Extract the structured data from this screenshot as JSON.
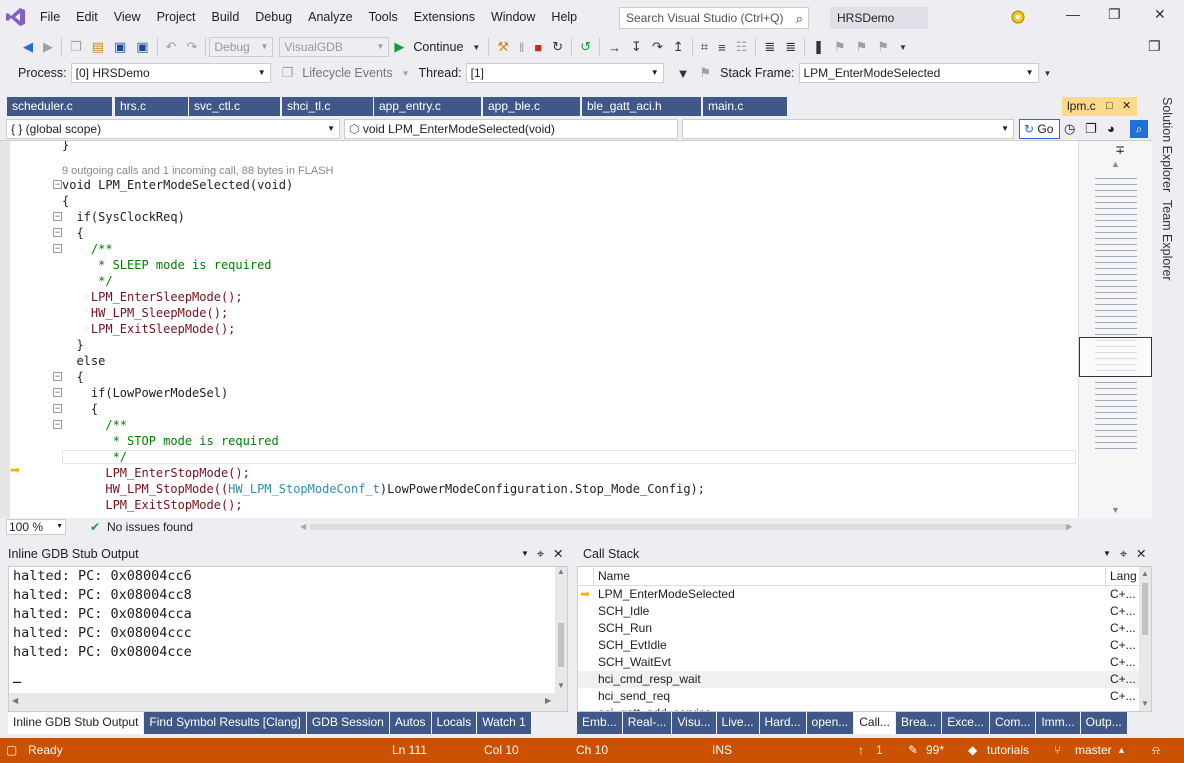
{
  "app": {
    "solution_name": "HRSDemo"
  },
  "menu": [
    "File",
    "Edit",
    "View",
    "Project",
    "Build",
    "Debug",
    "Analyze",
    "Tools",
    "Extensions",
    "Window",
    "Help"
  ],
  "search": {
    "placeholder": "Search Visual Studio (Ctrl+Q)"
  },
  "toolbar": {
    "config": "Debug",
    "platform": "VisualGDB",
    "continue_label": "Continue",
    "process_label": "Process:",
    "process_value": "[0] HRSDemo",
    "lifecycle_label": "Lifecycle Events",
    "thread_label": "Thread:",
    "thread_value": "[1]",
    "stackframe_label": "Stack Frame:",
    "stackframe_value": "LPM_EnterModeSelected"
  },
  "tabs": [
    "scheduler.c",
    "hrs.c",
    "svc_ctl.c",
    "shci_tl.c",
    "app_entry.c",
    "app_ble.c",
    "ble_gatt_aci.h",
    "main.c"
  ],
  "active_tab": "lpm.c",
  "navbar": {
    "scope": "{ } (global scope)",
    "function": "void LPM_EnterModeSelected(void)",
    "go_label": "Go"
  },
  "editor": {
    "codelens": "9 outgoing calls and 1 incoming call, 88 bytes in FLASH",
    "lines": [
      {
        "id": "l0",
        "text": "}"
      },
      {
        "id": "l1",
        "text": "void LPM_EnterModeSelected(void)"
      },
      {
        "id": "l2",
        "text": "{"
      },
      {
        "id": "l3",
        "text": "  if(SysClockReq)"
      },
      {
        "id": "l4",
        "text": "  {"
      },
      {
        "id": "l5",
        "text": "    /**"
      },
      {
        "id": "l6",
        "text": "     * SLEEP mode is required"
      },
      {
        "id": "l7",
        "text": "     */"
      },
      {
        "id": "l8",
        "text": "    LPM_EnterSleepMode();"
      },
      {
        "id": "l9",
        "text": "    HW_LPM_SleepMode();"
      },
      {
        "id": "l10",
        "text": "    LPM_ExitSleepMode();"
      },
      {
        "id": "l11",
        "text": "  }"
      },
      {
        "id": "l12",
        "text": "  else"
      },
      {
        "id": "l13",
        "text": "  {"
      },
      {
        "id": "l14",
        "text": "    if(LowPowerModeSel)"
      },
      {
        "id": "l15",
        "text": "    {"
      },
      {
        "id": "l16",
        "text": "      /**"
      },
      {
        "id": "l17",
        "text": "       * STOP mode is required"
      },
      {
        "id": "l18",
        "text": "       */"
      },
      {
        "id": "l19",
        "text": "      LPM_EnterStopMode();"
      },
      {
        "id": "l20a",
        "text": "      HW_LPM_StopMode(("
      },
      {
        "id": "l20b",
        "text": "HW_LPM_StopModeConf_t"
      },
      {
        "id": "l20c",
        "text": ")LowPowerModeConfiguration.Stop_Mode_Config);"
      },
      {
        "id": "l21",
        "text": "      LPM_ExitStopMode();"
      }
    ],
    "zoom": "100 %",
    "issues": "No issues found"
  },
  "gdb": {
    "title": "Inline GDB Stub Output",
    "lines": [
      "halted: PC: 0x08004cc6",
      "halted: PC: 0x08004cc8",
      "halted: PC: 0x08004cca",
      "halted: PC: 0x08004ccc",
      "halted: PC: 0x08004cce"
    ],
    "cursor": "_"
  },
  "bottom_left_tabs": [
    "Inline GDB Stub Output",
    "Find Symbol Results [Clang]",
    "GDB Session",
    "Autos",
    "Locals",
    "Watch 1"
  ],
  "callstack": {
    "title": "Call Stack",
    "columns": [
      "Name",
      "Lang"
    ],
    "rows": [
      {
        "name": "LPM_EnterModeSelected",
        "lang": "C+..."
      },
      {
        "name": "SCH_Idle",
        "lang": "C+..."
      },
      {
        "name": "SCH_Run",
        "lang": "C+..."
      },
      {
        "name": "SCH_EvtIdle",
        "lang": "C+..."
      },
      {
        "name": "SCH_WaitEvt",
        "lang": "C+..."
      },
      {
        "name": "hci_cmd_resp_wait",
        "lang": "C+..."
      },
      {
        "name": "hci_send_req",
        "lang": "C+..."
      },
      {
        "name": "aci_gatt_add_service",
        "lang": ""
      }
    ]
  },
  "bottom_right_tabs": [
    "Emb...",
    "Real-...",
    "Visu...",
    "Live...",
    "Hard...",
    "open...",
    "Call...",
    "Brea...",
    "Exce...",
    "Com...",
    "Imm...",
    "Outp..."
  ],
  "sidebar": [
    "Solution Explorer",
    "Team Explorer"
  ],
  "status": {
    "ready": "Ready",
    "ln": "Ln 111",
    "col": "Col 10",
    "ch": "Ch 10",
    "ins": "INS",
    "pushes": "1",
    "edits": "99*",
    "repo": "tutorials",
    "branch": "master"
  },
  "colors": {
    "status_bar": "#ca5100",
    "tab_bg": "#3f5888",
    "active_tab": "#fdd98a",
    "comment": "#008000"
  }
}
